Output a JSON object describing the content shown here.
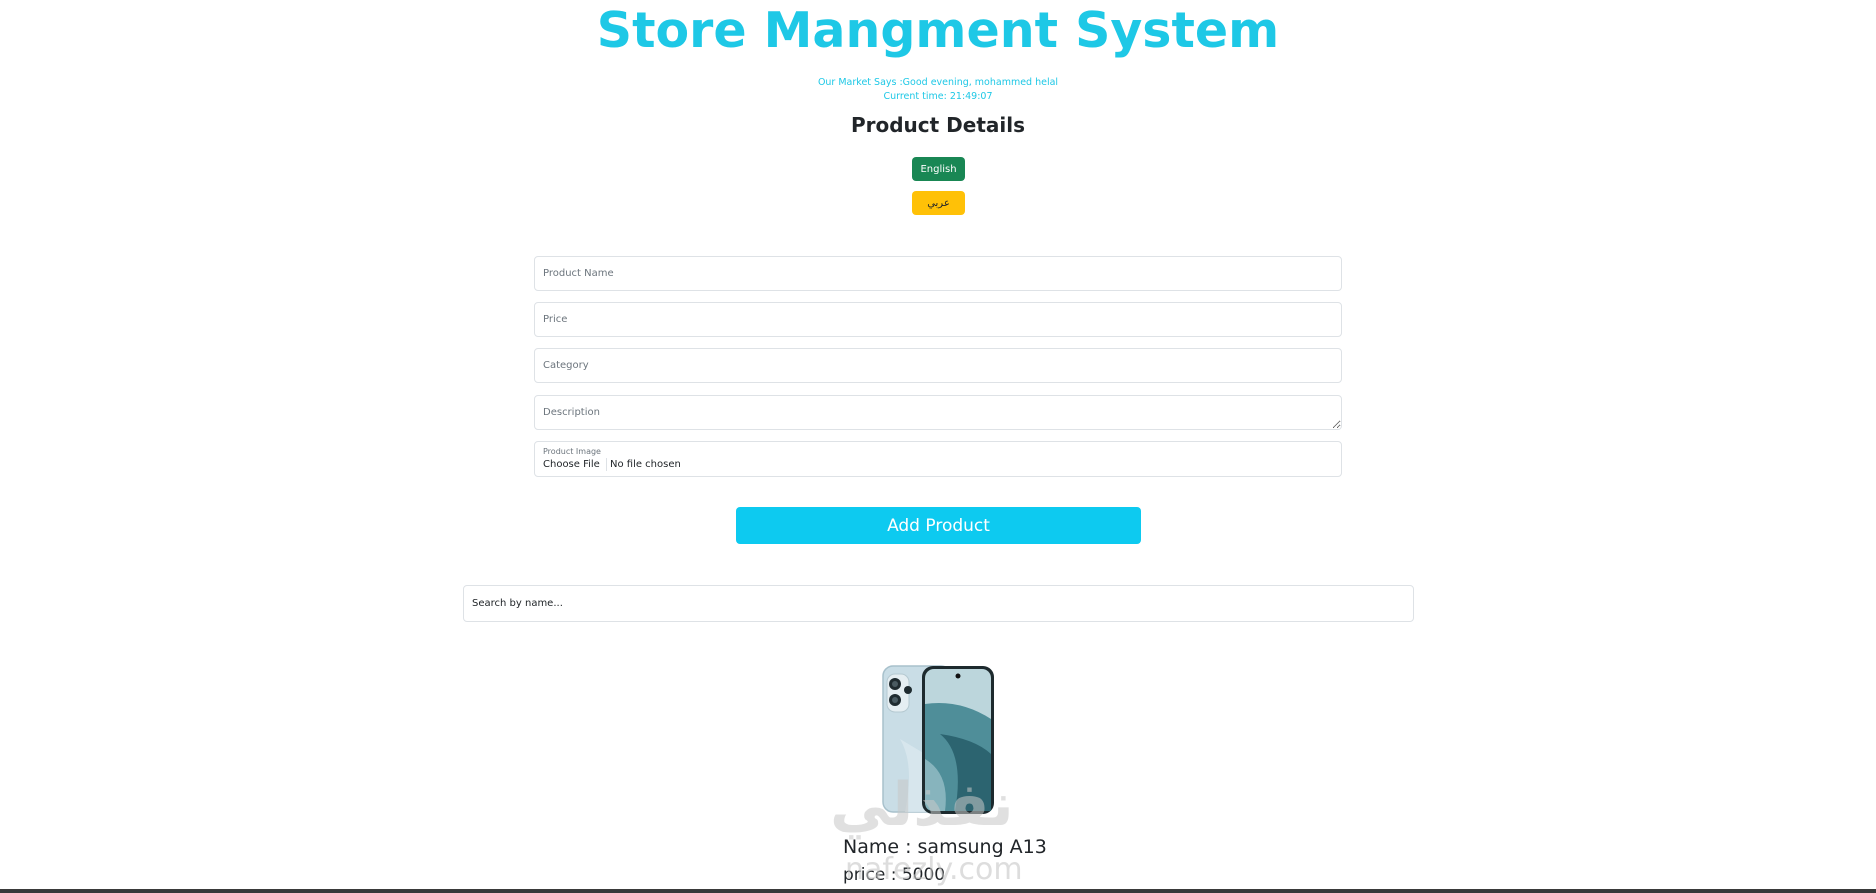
{
  "header": {
    "title": "Store Mangment System",
    "greeting": "Our Market Says :Good evening, mohammed helal",
    "time": "Current time: 21:49:07"
  },
  "form": {
    "section_title": "Product Details",
    "lang_english": "English",
    "lang_arabic": "عربي",
    "name_placeholder": "Product Name",
    "price_placeholder": "Price",
    "category_placeholder": "Category",
    "description_placeholder": "Description",
    "image_label": "Product Image",
    "choose_file": "Choose File",
    "file_status": "No file chosen",
    "add_button": "Add Product"
  },
  "search": {
    "placeholder": "Search by name..."
  },
  "product": {
    "name": "Name : samsung A13",
    "price": "price : 5000"
  },
  "watermark": {
    "arabic": "نفذلي",
    "latin": "nafezly.com"
  },
  "colors": {
    "accent": "#1ec8e6",
    "english_button": "#198754",
    "arabic_button": "#ffc107",
    "add_button": "#0dcaf0"
  }
}
